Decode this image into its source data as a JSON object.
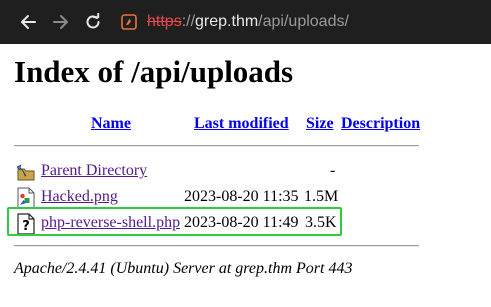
{
  "browser": {
    "url": {
      "scheme": "https",
      "separator": "://",
      "host": "grep.thm",
      "path": "/api/uploads/"
    },
    "icons": {
      "back": "back-arrow-icon",
      "forward": "forward-arrow-icon",
      "reload": "reload-icon",
      "site": "insecure-site-icon"
    },
    "colors": {
      "toolbar": "#1f1f1f",
      "scheme_strike": "#e5484d",
      "site_icon": "#e8743b"
    }
  },
  "page": {
    "title": "Index of /api/uploads",
    "columns": {
      "name": "Name",
      "last_modified": "Last modified",
      "size": "Size",
      "description": "Description"
    },
    "rows": [
      {
        "icon": "parent-directory-icon",
        "name": "Parent Directory",
        "modified": "",
        "size": "-"
      },
      {
        "icon": "image-file-icon",
        "name": "Hacked.png",
        "modified": "2023-08-20 11:35",
        "size": "1.5M"
      },
      {
        "icon": "unknown-file-icon",
        "name": "php-reverse-shell.php",
        "modified": "2023-08-20 11:49",
        "size": "3.5K"
      }
    ],
    "server_signature": "Apache/2.4.41 (Ubuntu) Server at grep.thm Port 443",
    "colors": {
      "link": "#0000ee",
      "visited_link": "#551a8b",
      "highlight": "#2ecc40"
    }
  }
}
